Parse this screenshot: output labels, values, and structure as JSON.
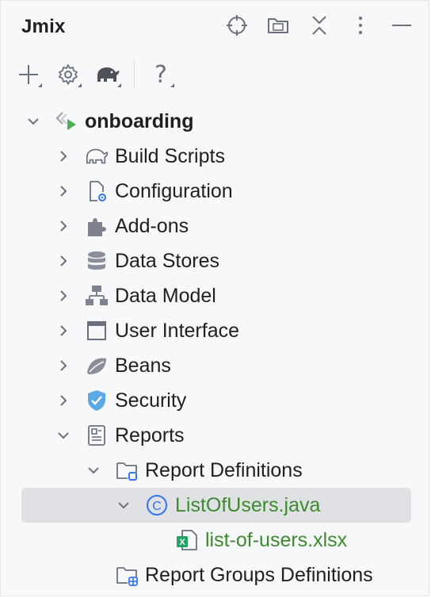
{
  "panel": {
    "title": "Jmix",
    "title_icons": [
      "locate-icon",
      "folder-icon",
      "collapse-all-icon",
      "more-icon",
      "minimize-icon"
    ]
  },
  "toolbar": {
    "items": [
      {
        "icon": "add-icon"
      },
      {
        "icon": "gear-icon"
      },
      {
        "icon": "gradle-elephant-icon"
      },
      {
        "icon": "help-icon",
        "glyph": "?"
      }
    ]
  },
  "tree": {
    "project": {
      "label": "onboarding",
      "expanded": true
    },
    "items": [
      {
        "label": "Build Scripts",
        "icon": "gradle-elephant-icon",
        "expanded": false
      },
      {
        "label": "Configuration",
        "icon": "configuration-icon",
        "expanded": false
      },
      {
        "label": "Add-ons",
        "icon": "puzzle-icon",
        "expanded": false
      },
      {
        "label": "Data Stores",
        "icon": "database-icon",
        "expanded": false
      },
      {
        "label": "Data Model",
        "icon": "hierarchy-icon",
        "expanded": false
      },
      {
        "label": "User Interface",
        "icon": "window-icon",
        "expanded": false
      },
      {
        "label": "Beans",
        "icon": "bean-leaf-icon",
        "expanded": false
      },
      {
        "label": "Security",
        "icon": "shield-icon",
        "expanded": false
      },
      {
        "label": "Reports",
        "icon": "report-icon",
        "expanded": true
      },
      {
        "label": "Report Definitions",
        "icon": "folder-report-icon",
        "expanded": true
      },
      {
        "label": "ListOfUsers.java",
        "icon": "class-icon",
        "class_letter": "C",
        "expanded": true,
        "selected": true
      },
      {
        "label": "list-of-users.xlsx",
        "icon": "excel-file-icon"
      },
      {
        "label": "Report Groups Definitions",
        "icon": "folder-grid-icon"
      }
    ]
  },
  "colors": {
    "panel_bg": "#f7f8fa",
    "selection_bg": "#dfe1e5",
    "icon_gray": "#6c707e",
    "accent_blue": "#3574f0",
    "file_green": "#3e8a2f"
  }
}
